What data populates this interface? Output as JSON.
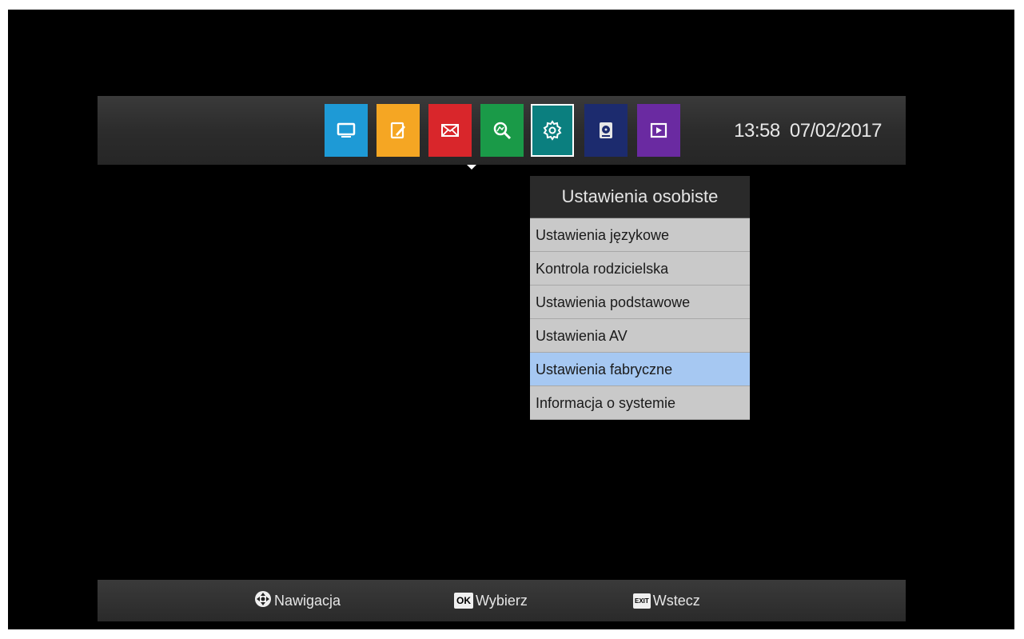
{
  "clock": {
    "time": "13:58",
    "date": "07/02/2017"
  },
  "top_bar": {
    "icons": [
      {
        "name": "tv-icon",
        "color": "#1e9ad6"
      },
      {
        "name": "edit-icon",
        "color": "#f5a623"
      },
      {
        "name": "mail-icon",
        "color": "#d9262b"
      },
      {
        "name": "search-icon",
        "color": "#1a9a48"
      },
      {
        "name": "settings-gear-icon",
        "color": "#0b7f7f",
        "selected": true
      },
      {
        "name": "media-disk-icon",
        "color": "#1c2b6e"
      },
      {
        "name": "play-icon",
        "color": "#6a2aa1"
      }
    ]
  },
  "menu": {
    "title": "Ustawienia osobiste",
    "items": [
      {
        "label": "Ustawienia językowe"
      },
      {
        "label": "Kontrola rodzicielska"
      },
      {
        "label": "Ustawienia podstawowe"
      },
      {
        "label": "Ustawienia AV"
      },
      {
        "label": "Ustawienia fabryczne",
        "highlighted": true
      },
      {
        "label": "Informacja o systemie"
      }
    ]
  },
  "hints": {
    "navigate_label": "Nawigacja",
    "ok_key": "OK",
    "ok_label": "Wybierz",
    "exit_key": "EXIT",
    "exit_label": "Wstecz"
  }
}
